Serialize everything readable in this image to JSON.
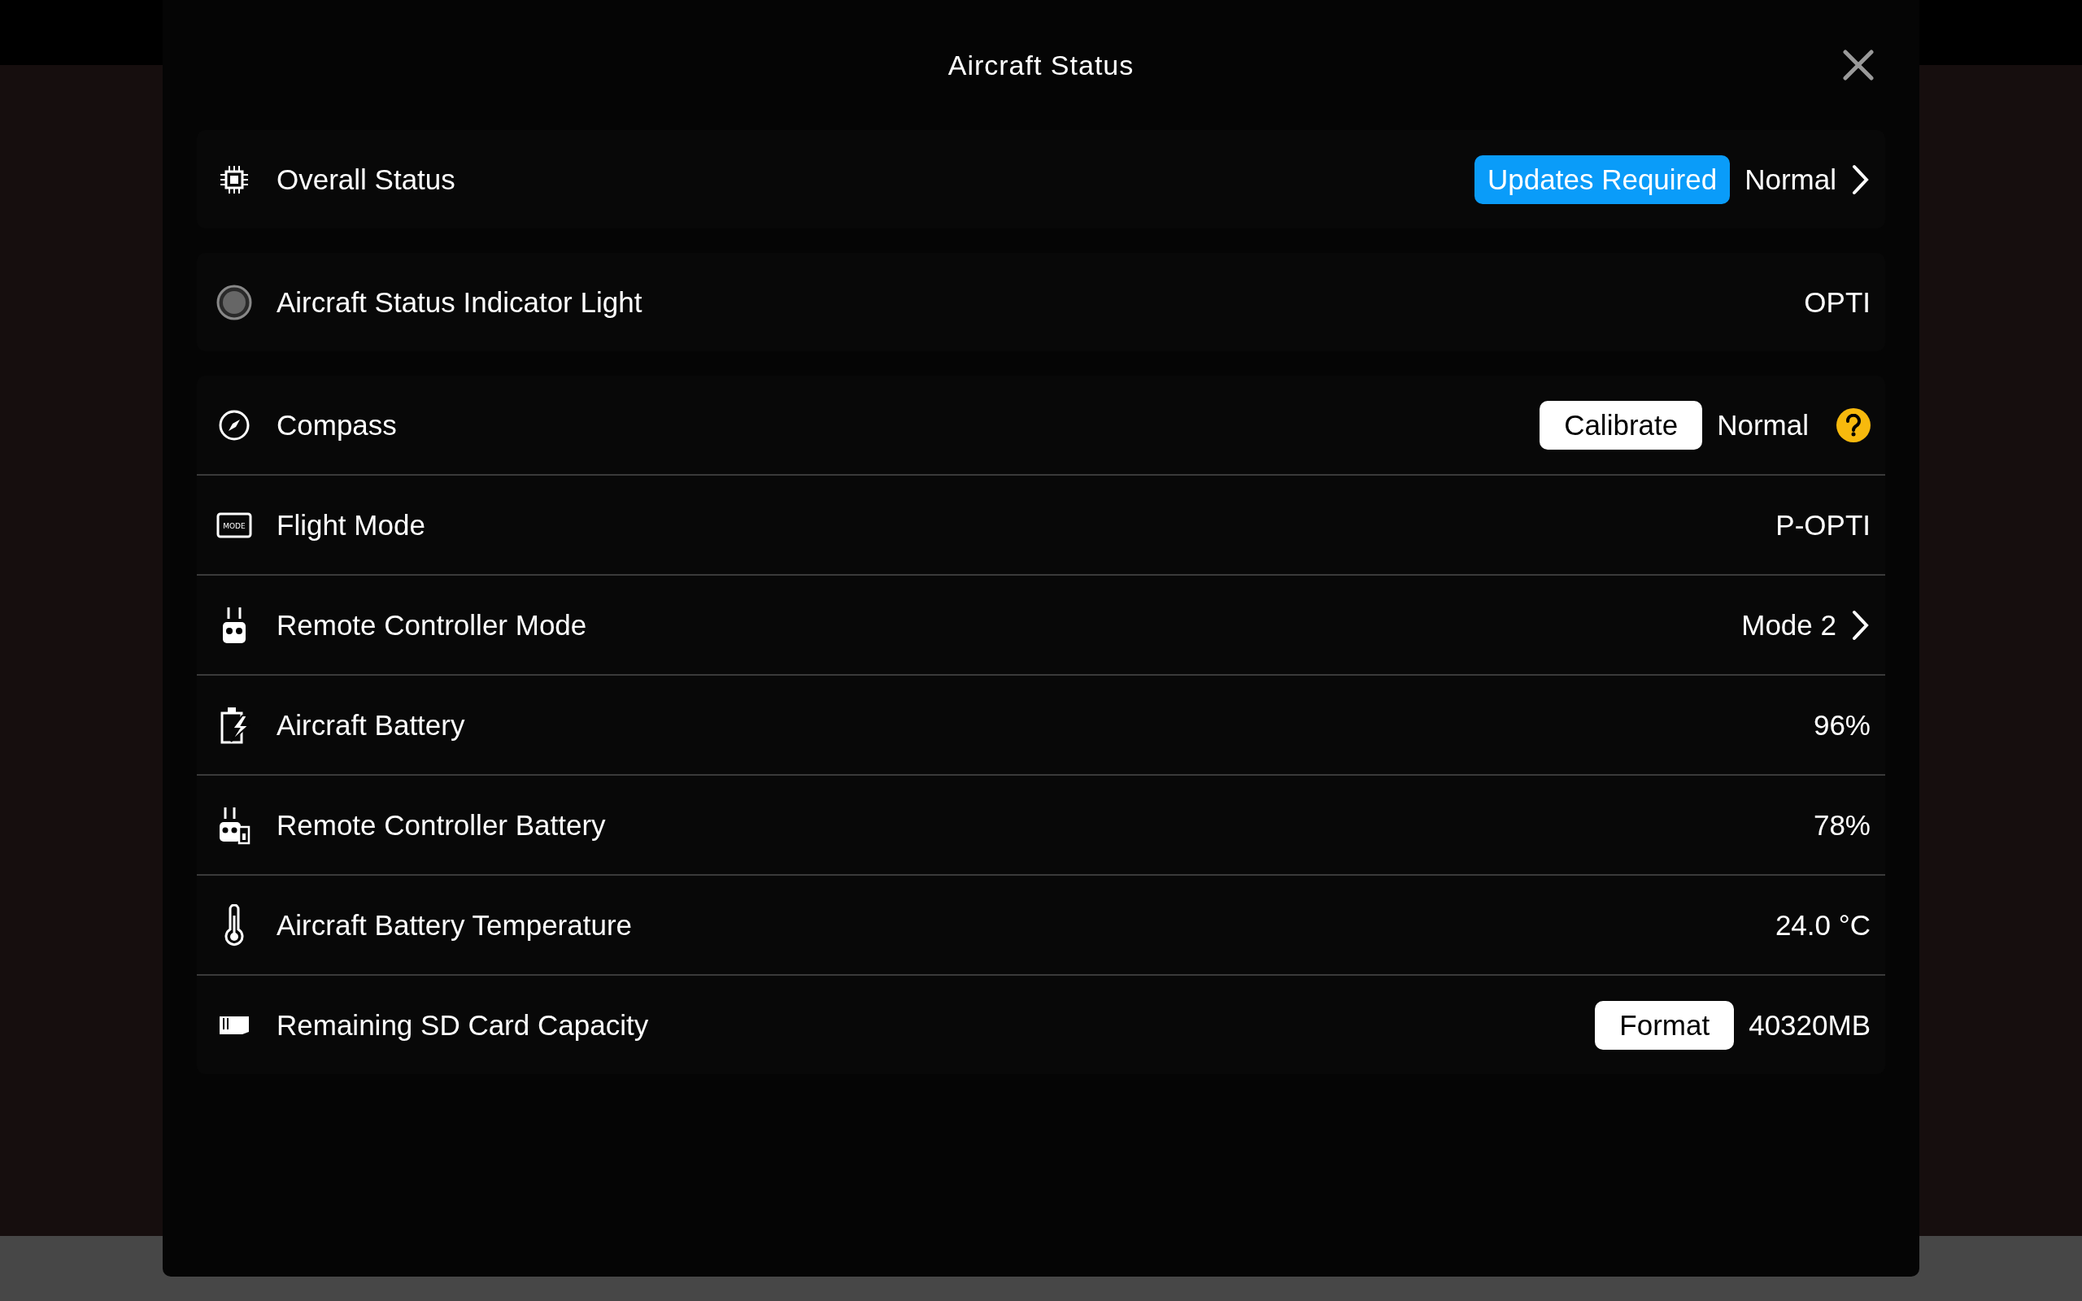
{
  "dialog": {
    "title": "Aircraft Status"
  },
  "sections": [
    {
      "rows": [
        {
          "label": "Overall Status",
          "badge": "Updates Required",
          "value": "Normal",
          "chevron": true,
          "help": false
        }
      ]
    },
    {
      "rows": [
        {
          "label": "Aircraft Status Indicator Light",
          "value": "OPTI",
          "chevron": false,
          "help": false
        }
      ]
    },
    {
      "rows": [
        {
          "label": "Compass",
          "button": "Calibrate",
          "value": "Normal",
          "chevron": false,
          "help": true
        },
        {
          "label": "Flight Mode",
          "icon_text": "MODE",
          "value": "P-OPTI",
          "chevron": false,
          "help": false
        },
        {
          "label": "Remote Controller Mode",
          "value": "Mode 2",
          "chevron": true,
          "help": false
        },
        {
          "label": "Aircraft Battery",
          "value": "96%",
          "chevron": false,
          "help": false
        },
        {
          "label": "Remote Controller Battery",
          "value": "78%",
          "chevron": false,
          "help": false
        },
        {
          "label": "Aircraft Battery Temperature",
          "value": "24.0 °C",
          "chevron": false,
          "help": false
        },
        {
          "label": "Remaining SD Card Capacity",
          "button": "Format",
          "value": "40320MB",
          "chevron": false,
          "help": false
        }
      ]
    }
  ]
}
